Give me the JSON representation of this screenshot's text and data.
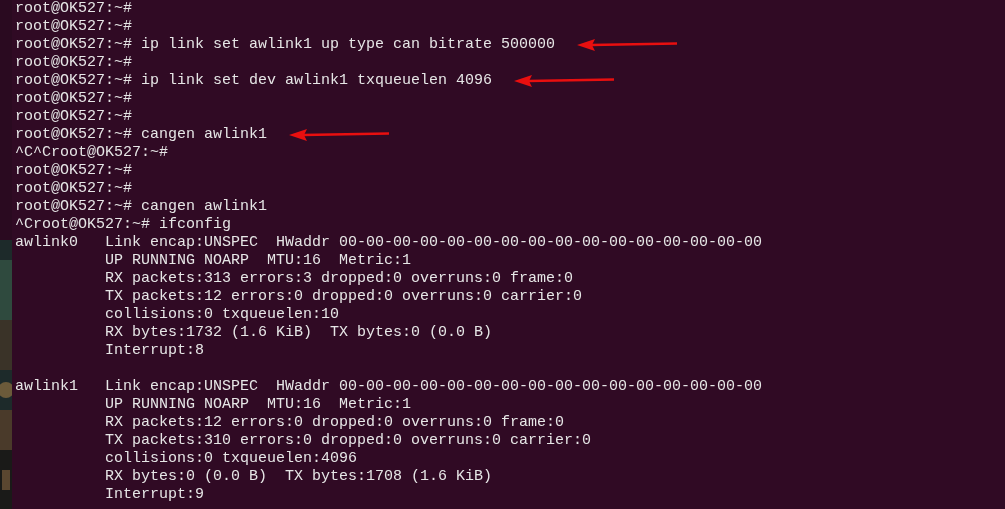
{
  "terminal": {
    "lines": [
      {
        "kind": "text",
        "text": "root@OK527:~#",
        "annotated": false
      },
      {
        "kind": "text",
        "text": "root@OK527:~#",
        "annotated": false
      },
      {
        "kind": "text",
        "text": "root@OK527:~# ip link set awlink1 up type can bitrate 500000",
        "annotated": true
      },
      {
        "kind": "text",
        "text": "root@OK527:~#",
        "annotated": false
      },
      {
        "kind": "text",
        "text": "root@OK527:~# ip link set dev awlink1 txqueuelen 4096",
        "annotated": true
      },
      {
        "kind": "text",
        "text": "root@OK527:~#",
        "annotated": false
      },
      {
        "kind": "text",
        "text": "root@OK527:~#",
        "annotated": false
      },
      {
        "kind": "text",
        "text": "root@OK527:~# cangen awlink1",
        "annotated": true
      },
      {
        "kind": "text",
        "text": "^C^Croot@OK527:~#",
        "annotated": false
      },
      {
        "kind": "text",
        "text": "root@OK527:~#",
        "annotated": false
      },
      {
        "kind": "text",
        "text": "root@OK527:~#",
        "annotated": false
      },
      {
        "kind": "text",
        "text": "root@OK527:~# cangen awlink1",
        "annotated": false
      },
      {
        "kind": "text",
        "text": "^Croot@OK527:~# ifconfig",
        "annotated": false
      },
      {
        "kind": "text",
        "text": "awlink0   Link encap:UNSPEC  HWaddr 00-00-00-00-00-00-00-00-00-00-00-00-00-00-00-00",
        "annotated": false
      },
      {
        "kind": "text",
        "text": "          UP RUNNING NOARP  MTU:16  Metric:1",
        "annotated": false
      },
      {
        "kind": "text",
        "text": "          RX packets:313 errors:3 dropped:0 overruns:0 frame:0",
        "annotated": false
      },
      {
        "kind": "text",
        "text": "          TX packets:12 errors:0 dropped:0 overruns:0 carrier:0",
        "annotated": false
      },
      {
        "kind": "text",
        "text": "          collisions:0 txqueuelen:10",
        "annotated": false
      },
      {
        "kind": "text",
        "text": "          RX bytes:1732 (1.6 KiB)  TX bytes:0 (0.0 B)",
        "annotated": false
      },
      {
        "kind": "text",
        "text": "          Interrupt:8",
        "annotated": false
      },
      {
        "kind": "blank"
      },
      {
        "kind": "text",
        "text": "awlink1   Link encap:UNSPEC  HWaddr 00-00-00-00-00-00-00-00-00-00-00-00-00-00-00-00",
        "annotated": false
      },
      {
        "kind": "text",
        "text": "          UP RUNNING NOARP  MTU:16  Metric:1",
        "annotated": false
      },
      {
        "kind": "text",
        "text": "          RX packets:12 errors:0 dropped:0 overruns:0 frame:0",
        "annotated": false
      },
      {
        "kind": "text",
        "text": "          TX packets:310 errors:0 dropped:0 overruns:0 carrier:0",
        "annotated": false
      },
      {
        "kind": "text",
        "text": "          collisions:0 txqueuelen:4096",
        "annotated": false
      },
      {
        "kind": "text",
        "text": "          RX bytes:0 (0.0 B)  TX bytes:1708 (1.6 KiB)",
        "annotated": false
      },
      {
        "kind": "text",
        "text": "          Interrupt:9",
        "annotated": false
      }
    ]
  }
}
